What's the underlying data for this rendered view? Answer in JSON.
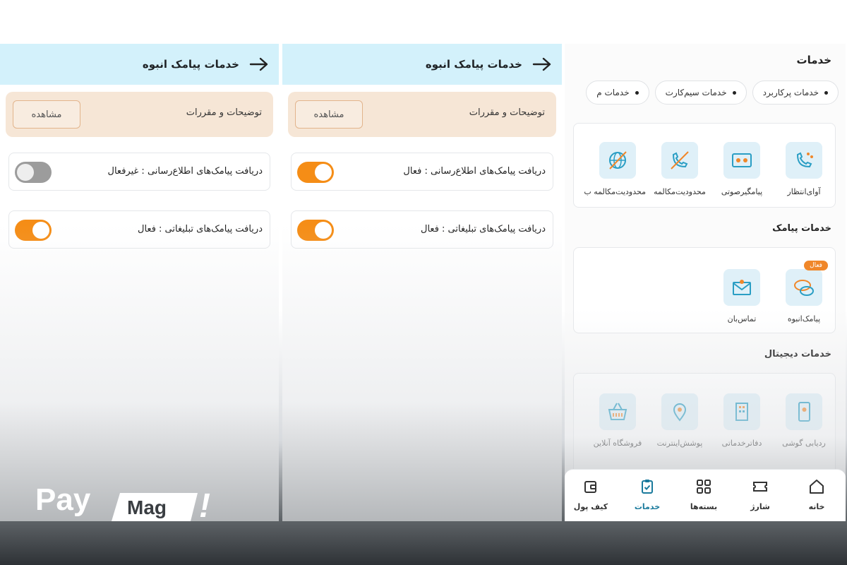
{
  "bulk_sms_screen": {
    "title": "خدمات پیامک انبوه",
    "rules_label": "توضیحات و مقررات",
    "view_button": "مشاهده"
  },
  "panel_left": {
    "info_sms": "دریافت پیامک‌های اطلاع‌رسانی : غیرفعال",
    "ad_sms": "دریافت پیامک‌های تبلیغاتی : فعال",
    "info_on": false,
    "ad_on": true
  },
  "panel_middle": {
    "info_sms": "دریافت پیامک‌های اطلاع‌رسانی : فعال",
    "ad_sms": "دریافت پیامک‌های تبلیغاتی : فعال",
    "info_on": true,
    "ad_on": true
  },
  "services_screen": {
    "title": "خدمات",
    "pills": [
      "خدمات پرکاربرد",
      "خدمات سیم‌کارت",
      "خدمات م"
    ],
    "top_services": [
      "آوای‌انتظار",
      "پیامگیرصوتی",
      "محدودیت‌مکالمه",
      "محدودیت‌مکالمه ب"
    ],
    "sms_title": "خدمات پیامک",
    "sms_services": [
      "پیامک‌انبوه",
      "تماس‌بان"
    ],
    "active_badge": "فعال",
    "digital_title": "خدمات دیجیتال",
    "digital_services": [
      "ردیابی گوشی",
      "دفاترخدماتی",
      "پوشش‌اینترنت",
      "فروشگاه آنلاین"
    ],
    "nav": [
      "خانه",
      "شارژ",
      "بسته‌ها",
      "خدمات",
      "کیف پول"
    ],
    "nav_active": "خدمات"
  },
  "brand": {
    "pay": "Pay",
    "mag": "Mag",
    "exclaim": "!"
  },
  "colors": {
    "header_bg": "#d3f1fb",
    "toggle_on": "#f58d16",
    "toggle_off": "#9c9c9c",
    "rules_bg": "#f6e6d6",
    "icon_bg": "#dff0f8",
    "badge": "#f0872a"
  }
}
